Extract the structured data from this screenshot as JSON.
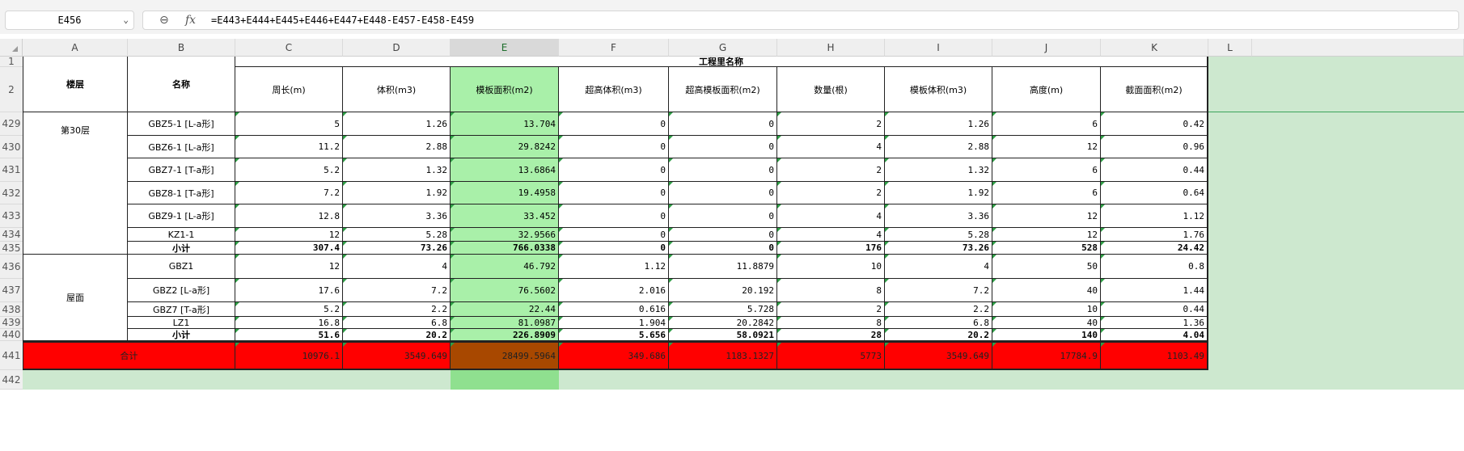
{
  "formula_bar": {
    "name_box": "E456",
    "fx_label": "fx",
    "formula": "=E443+E444+E445+E446+E447+E448-E457-E458-E459"
  },
  "columns": [
    "A",
    "B",
    "C",
    "D",
    "E",
    "F",
    "G",
    "H",
    "I",
    "J",
    "K",
    "L"
  ],
  "selected_column": "E",
  "header": {
    "floor": "楼层",
    "name": "名称",
    "group": "工程里名称",
    "fields": [
      "周长(m)",
      "体积(m3)",
      "模板面积(m2)",
      "超高体积(m3)",
      "超高模板面积(m2)",
      "数量(根)",
      "模板体积(m3)",
      "高度(m)",
      "截面面积(m2)"
    ]
  },
  "row_numbers": [
    "1",
    "2",
    "429",
    "430",
    "431",
    "432",
    "433",
    "434",
    "435",
    "436",
    "437",
    "438",
    "439",
    "440",
    "441",
    "442"
  ],
  "groups": [
    {
      "floor": "第30层",
      "rows": [
        {
          "name": "GBZ5-1 [L-a形]",
          "values": [
            "5",
            "1.26",
            "13.704",
            "0",
            "0",
            "2",
            "1.26",
            "6",
            "0.42"
          ]
        },
        {
          "name": "GBZ6-1 [L-a形]",
          "values": [
            "11.2",
            "2.88",
            "29.8242",
            "0",
            "0",
            "4",
            "2.88",
            "12",
            "0.96"
          ]
        },
        {
          "name": "GBZ7-1 [T-a形]",
          "values": [
            "5.2",
            "1.32",
            "13.6864",
            "0",
            "0",
            "2",
            "1.32",
            "6",
            "0.44"
          ]
        },
        {
          "name": "GBZ8-1 [T-a形]",
          "values": [
            "7.2",
            "1.92",
            "19.4958",
            "0",
            "0",
            "2",
            "1.92",
            "6",
            "0.64"
          ]
        },
        {
          "name": "GBZ9-1 [L-a形]",
          "values": [
            "12.8",
            "3.36",
            "33.452",
            "0",
            "0",
            "4",
            "3.36",
            "12",
            "1.12"
          ]
        },
        {
          "name": "KZ1-1",
          "values": [
            "12",
            "5.28",
            "32.9566",
            "0",
            "0",
            "4",
            "5.28",
            "12",
            "1.76"
          ]
        }
      ],
      "subtotal": {
        "label": "小计",
        "values": [
          "307.4",
          "73.26",
          "766.0338",
          "0",
          "0",
          "176",
          "73.26",
          "528",
          "24.42"
        ]
      }
    },
    {
      "floor": "屋面",
      "rows": [
        {
          "name": "GBZ1",
          "values": [
            "12",
            "4",
            "46.792",
            "1.12",
            "11.8879",
            "10",
            "4",
            "50",
            "0.8"
          ]
        },
        {
          "name": "GBZ2 [L-a形]",
          "values": [
            "17.6",
            "7.2",
            "76.5602",
            "2.016",
            "20.192",
            "8",
            "7.2",
            "40",
            "1.44"
          ]
        },
        {
          "name": "GBZ7 [T-a形]",
          "values": [
            "5.2",
            "2.2",
            "22.44",
            "0.616",
            "5.728",
            "2",
            "2.2",
            "10",
            "0.44"
          ]
        },
        {
          "name": "LZ1",
          "values": [
            "16.8",
            "6.8",
            "81.0987",
            "1.904",
            "20.2842",
            "8",
            "6.8",
            "40",
            "1.36"
          ]
        }
      ],
      "subtotal": {
        "label": "小计",
        "values": [
          "51.6",
          "20.2",
          "226.8909",
          "5.656",
          "58.0921",
          "28",
          "20.2",
          "140",
          "4.04"
        ]
      }
    }
  ],
  "total": {
    "label": "合计",
    "values": [
      "10976.1",
      "3549.649",
      "28499.5964",
      "349.686",
      "1183.1327",
      "5773",
      "3549.649",
      "17784.9",
      "1103.49"
    ]
  },
  "colors": {
    "selected_column": "#a9f0a9",
    "total_row": "#ff0000",
    "total_active_cell": "#a84800",
    "beyond_region": "#cde8cf",
    "comment_marker": "#2e9e45"
  }
}
